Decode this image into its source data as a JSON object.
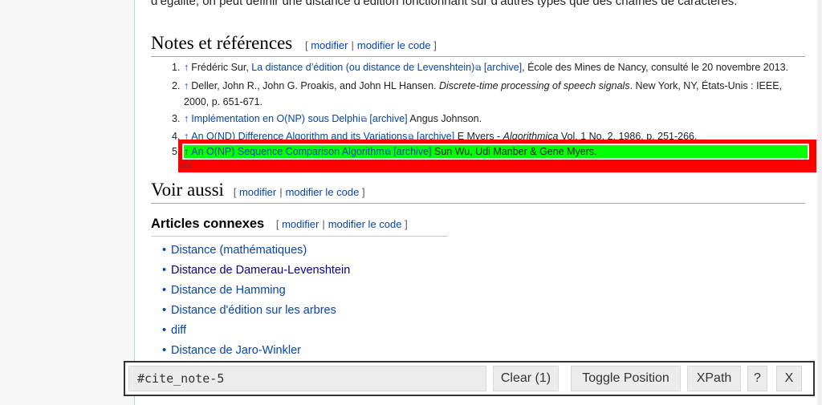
{
  "top_text": "d’égalité, on peut définir une distance d’édition fonctionnant sur d’autres types que des chaînes de caractères.",
  "notes": {
    "title": "Notes et références",
    "edit": "modifier",
    "edit_code": "modifier le code"
  },
  "refs": [
    {
      "num": "1.",
      "up": "↑",
      "link": "La distance d’édition (ou distance de Levenshtein)",
      "archive": "[archive]",
      "pre": "Frédéric Sur, ",
      "post": ", École des Mines de Nancy, consulté le 20 novembre 2013."
    },
    {
      "num": "2.",
      "up": "↑",
      "text": "Deller, John R., John G. Proakis, and John HL Hansen. ",
      "italic": "Discrete-time processing of speech signals",
      "post": ". New York, NY, États-Unis : IEEE, 2000, p. 651-671."
    },
    {
      "num": "3.",
      "up": "↑",
      "link": "Implémentation en O(NP) sous Delphi",
      "archive": "[archive]",
      "post": " Angus Johnson."
    },
    {
      "num": "4.",
      "up": "↑",
      "link": "An O(ND) Difference Algorithm and its Variations",
      "archive": "[archive]",
      "pre_it": " E Myers - ",
      "italic": "Algorithmica",
      "post": " Vol. 1 No. 2, 1986, p. 251-266."
    },
    {
      "num": "5.",
      "up": "↑",
      "link": "An O(NP) Sequence Comparison Algorithm",
      "archive": "[archive]",
      "post": " Sun Wu, Udi Manber & Gene Myers."
    }
  ],
  "highlight_label": "ol li",
  "voir": {
    "title": "Voir aussi",
    "edit": "modifier",
    "edit_code": "modifier le code"
  },
  "articles": {
    "title": "Articles connexes",
    "edit": "modifier",
    "edit_code": "modifier le code",
    "items": [
      "Distance (mathématiques)",
      "Distance de Damerau-Levenshtein",
      "Distance de Hamming",
      "Distance d'édition sur les arbres",
      "diff",
      "Distance de Jaro-Winkler"
    ]
  },
  "toolbar": {
    "selector_value": "#cite_note-5",
    "clear": "Clear (1)",
    "toggle": "Toggle Position",
    "xpath": "XPath",
    "help": "?",
    "close": "X"
  }
}
